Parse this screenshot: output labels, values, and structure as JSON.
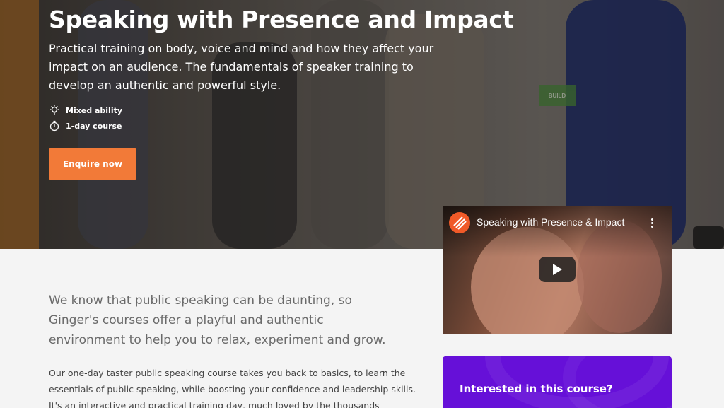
{
  "hero": {
    "title": "Speaking with Presence and Impact",
    "subtitle": "Practical training on body, voice and mind and how they affect your impact on an audience. The fundamentals of speaker training to develop an authentic and powerful style.",
    "meta": [
      {
        "icon": "bulb-icon",
        "label": "Mixed ability"
      },
      {
        "icon": "stopwatch-icon",
        "label": "1-day course"
      }
    ],
    "cta_label": "Enquire now",
    "background_sign": "BUILD"
  },
  "video": {
    "title": "Speaking with Presence & Impact",
    "icon": "channel-logo-icon"
  },
  "content": {
    "lead": "We know that public speaking can be daunting, so Ginger's courses offer a playful and authentic environment to help you to relax, experiment and grow.",
    "body": "Our one-day taster public speaking course takes you back to basics, to learn the essentials of public speaking, while boosting your confidence and leadership skills. It's an interactive and practical training day, much loved by the thousands"
  },
  "interest_card": {
    "title": "Interested in this course?"
  },
  "colors": {
    "accent_orange": "#f27a38",
    "card_purple": "#6610d8",
    "background": "#f4f4f4"
  }
}
